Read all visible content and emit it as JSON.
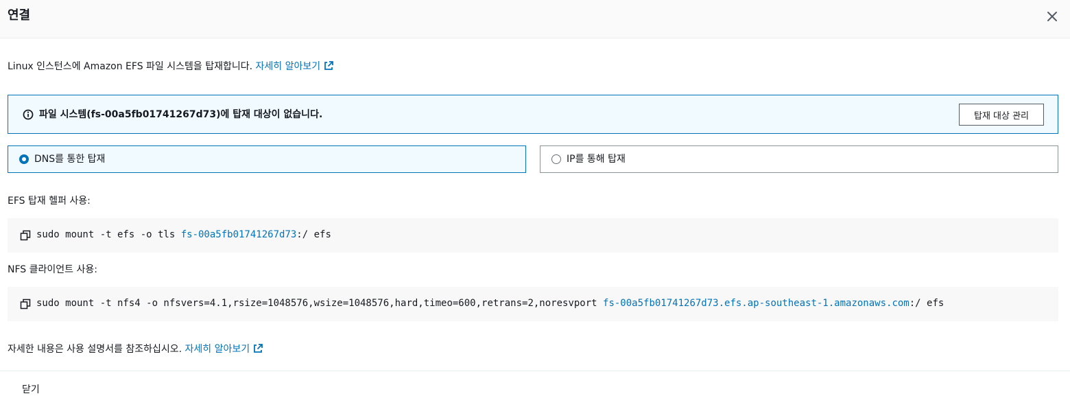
{
  "header": {
    "title": "연결"
  },
  "intro": {
    "text": "Linux 인스턴스에 Amazon EFS 파일 시스템을 탑재합니다. ",
    "link": "자세히 알아보기"
  },
  "alert": {
    "message": "파일 시스템(fs-00a5fb01741267d73)에 탑재 대상이 없습니다.",
    "button": "탑재 대상 관리"
  },
  "mount_options": [
    {
      "label": "DNS를 통한 탑재",
      "selected": true
    },
    {
      "label": "IP를 통해 탑재",
      "selected": false
    }
  ],
  "helper": {
    "label": "EFS 탑재 헬퍼 사용:",
    "cmd_prefix": "sudo mount -t efs -o tls ",
    "cmd_target": "fs-00a5fb01741267d73",
    "cmd_suffix": ":/ efs"
  },
  "nfs": {
    "label": "NFS 클라이언트 사용:",
    "cmd_prefix": "sudo mount -t nfs4 -o nfsvers=4.1,rsize=1048576,wsize=1048576,hard,timeo=600,retrans=2,noresvport ",
    "cmd_target": "fs-00a5fb01741267d73.efs.ap-southeast-1.amazonaws.com",
    "cmd_suffix": ":/ efs"
  },
  "footer": {
    "note": "자세한 내용은 사용 설명서를 참조하십시오. ",
    "link": "자세히 알아보기",
    "close_button": "닫기"
  },
  "colors": {
    "accent": "#0073bb",
    "alert_bg": "#f1faff",
    "code_bg": "#f8f8f8",
    "text": "#16191f"
  },
  "icons": [
    "close-icon",
    "external-link-icon",
    "info-icon",
    "copy-icon"
  ]
}
